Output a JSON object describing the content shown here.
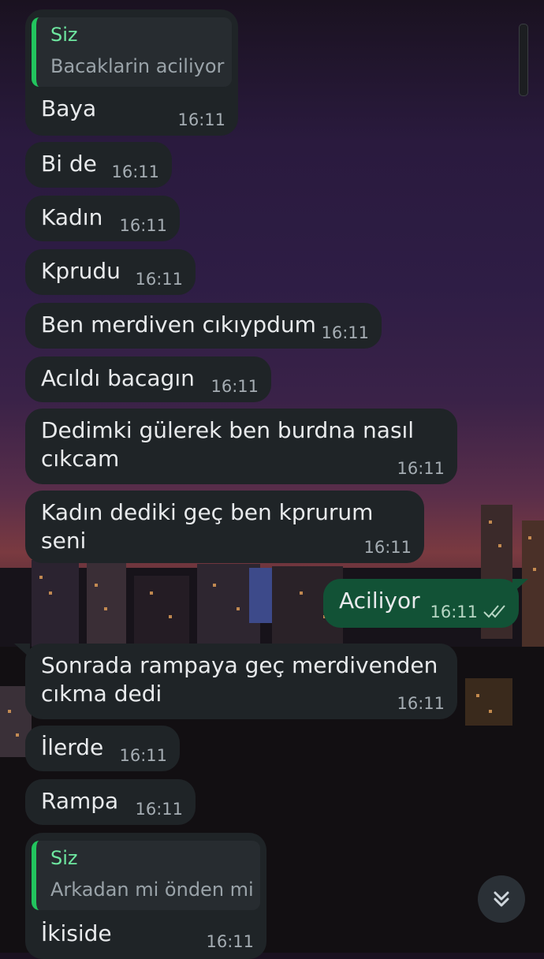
{
  "messages": [
    {
      "reply_name": "Siz",
      "reply_text": "Bacaklarin aciliyor",
      "text": "Baya",
      "time": "16:11"
    },
    {
      "text": "Bi de",
      "time": "16:11"
    },
    {
      "text": "Kadın",
      "time": "16:11"
    },
    {
      "text": "Kprudu",
      "time": "16:11"
    },
    {
      "text": "Ben merdiven cıkıypdum",
      "time": "16:11"
    },
    {
      "text": "Acıldı bacagın",
      "time": "16:11"
    },
    {
      "text": "Dedimki gülerek ben burdna nasıl\ncıkcam",
      "time": "16:11"
    },
    {
      "text": "Kadın dediki geç ben kprurum seni",
      "time": "16:11"
    },
    {
      "text": "Aciliyor",
      "time": "16:11",
      "status": "read-double-check"
    },
    {
      "text": "Sonrada rampaya geç merdivenden\ncıkma dedi",
      "time": "16:11"
    },
    {
      "text": "İlerde",
      "time": "16:11"
    },
    {
      "text": "Rampa",
      "time": "16:11"
    },
    {
      "reply_name": "Siz",
      "reply_text": "Arkadan mi önden mi",
      "text": "İkiside",
      "time": "16:11"
    }
  ],
  "colors": {
    "incoming_bubble": "#1f2427",
    "outgoing_bubble": "#125236",
    "reply_accent": "#22c55e",
    "reply_name": "#6ee7a0"
  },
  "icons": {
    "fab": "chevron-double-down-icon",
    "status": "double-check-icon"
  }
}
